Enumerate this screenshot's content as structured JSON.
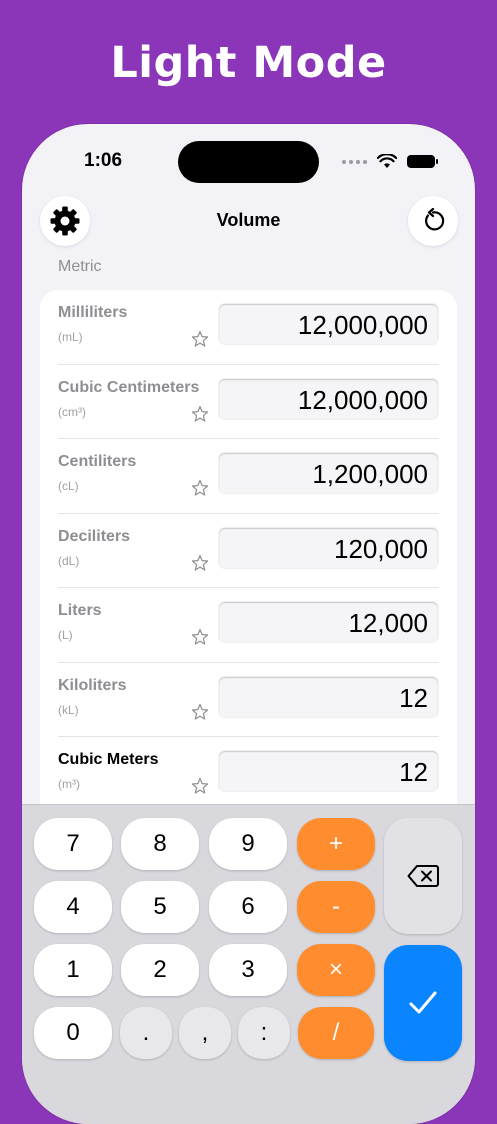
{
  "banner": {
    "title": "Light Mode"
  },
  "status": {
    "time": "1:06"
  },
  "nav": {
    "title": "Volume"
  },
  "section": {
    "title": "Metric"
  },
  "units": [
    {
      "name": "Milliliters",
      "abbr": "(mL)",
      "value": "12,000,000",
      "active": false
    },
    {
      "name": "Cubic Centimeters",
      "abbr": "(cm³)",
      "value": "12,000,000",
      "active": false
    },
    {
      "name": "Centiliters",
      "abbr": "(cL)",
      "value": "1,200,000",
      "active": false
    },
    {
      "name": "Deciliters",
      "abbr": "(dL)",
      "value": "120,000",
      "active": false
    },
    {
      "name": "Liters",
      "abbr": "(L)",
      "value": "12,000",
      "active": false
    },
    {
      "name": "Kiloliters",
      "abbr": "(kL)",
      "value": "12",
      "active": false
    },
    {
      "name": "Cubic Meters",
      "abbr": "(m³)",
      "value": "12",
      "active": true
    }
  ],
  "keypad": {
    "k7": "7",
    "k8": "8",
    "k9": "9",
    "plus": "+",
    "k4": "4",
    "k5": "5",
    "k6": "6",
    "minus": "-",
    "k1": "1",
    "k2": "2",
    "k3": "3",
    "times": "×",
    "k0": "0",
    "dot": ".",
    "comma": ",",
    "colon": ":",
    "divide": "/"
  },
  "colors": {
    "background": "#8b35b8",
    "operator": "#ff8c2e",
    "done": "#0a84ff"
  },
  "icons": {
    "settings": "gear-icon",
    "reset": "reset-arrow-icon",
    "favorite": "star-outline-icon",
    "delete": "backspace-icon",
    "done": "checkmark-icon"
  }
}
